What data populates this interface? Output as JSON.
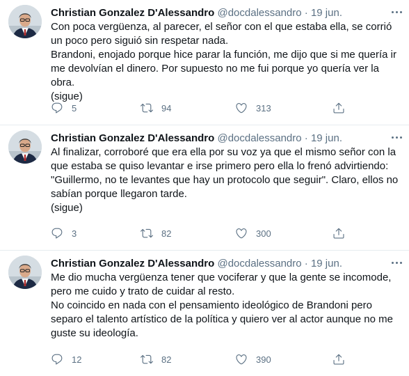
{
  "tweets": [
    {
      "author": "Christian Gonzalez D'Alessandro",
      "handle": "@docdalessandro",
      "separator": "·",
      "date": "19 jun.",
      "lines": [
        "Con poca vergüenza, al parecer, el señor con el que estaba ella, se corrió un poco pero siguió sin respetar nada.",
        "Brandoni, enojado porque hice parar la función, me dijo que si me quería ir me devolvían el dinero. Por supuesto no me fui porque yo quería ver la obra.",
        "(sigue)"
      ],
      "replies": "5",
      "retweets": "94",
      "likes": "313"
    },
    {
      "author": "Christian Gonzalez D'Alessandro",
      "handle": "@docdalessandro",
      "separator": "·",
      "date": "19 jun.",
      "lines": [
        "Al finalizar, corroboré que era ella por su voz ya que el mismo señor con la que estaba se quiso levantar e irse primero pero ella lo frenó advirtiendo: \"Guillermo, no te levantes que hay un protocolo que seguir\". Claro, ellos no sabían porque llegaron tarde.",
        "(sigue)"
      ],
      "replies": "3",
      "retweets": "82",
      "likes": "300"
    },
    {
      "author": "Christian Gonzalez D'Alessandro",
      "handle": "@docdalessandro",
      "separator": "·",
      "date": "19 jun.",
      "lines": [
        "Me dio mucha vergüenza tener que vociferar y que la gente se incomode, pero me cuido y trato de cuidar al resto.",
        "No coincido en nada con el pensamiento ideológico de Brandoni pero separo el talento artístico de la política y quiero ver al actor aunque no me guste su ideología."
      ],
      "replies": "12",
      "retweets": "82",
      "likes": "390"
    }
  ],
  "icons": {
    "reply": "reply-icon",
    "retweet": "retweet-icon",
    "like": "heart-icon",
    "share": "share-icon",
    "more": "more-icon"
  },
  "colors": {
    "text": "#0f1419",
    "secondary": "#5b7083",
    "divider": "#e6ecf0"
  }
}
